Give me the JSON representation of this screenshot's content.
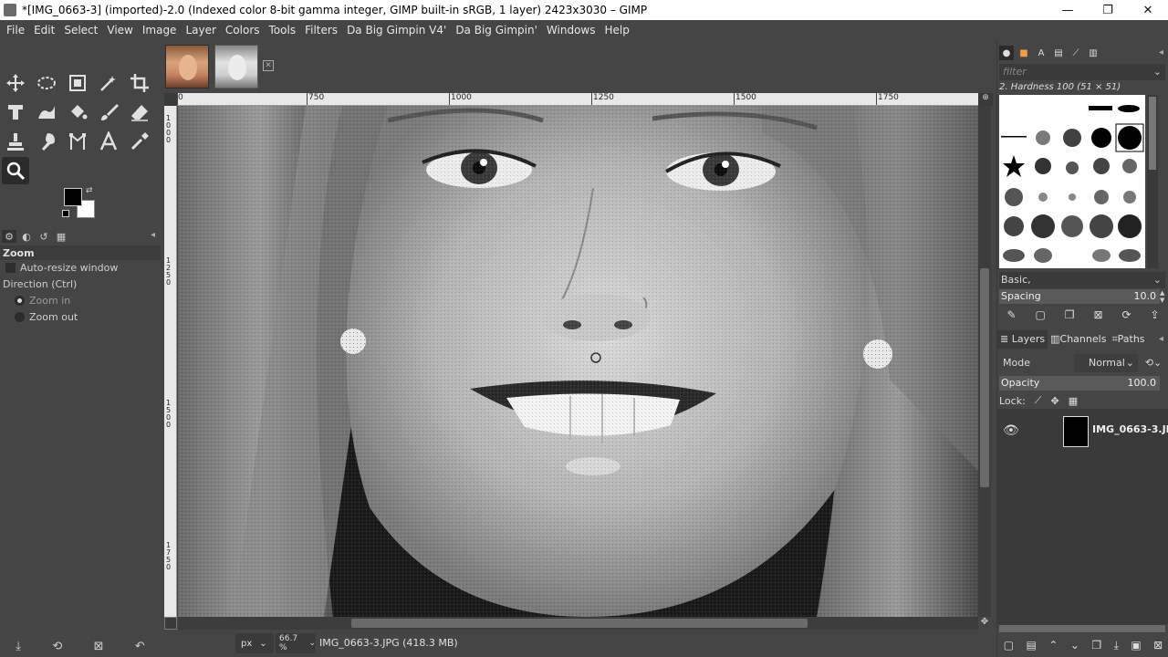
{
  "window": {
    "title": "*[IMG_0663-3] (imported)-2.0 (Indexed color 8-bit gamma integer, GIMP built-in sRGB, 1 layer) 2423x3030 – GIMP",
    "minimize": "—",
    "restore": "❐",
    "close": "✕"
  },
  "menu": [
    "File",
    "Edit",
    "Select",
    "View",
    "Image",
    "Layer",
    "Colors",
    "Tools",
    "Filters",
    "Da Big Gimpin V4'",
    "Da Big Gimpin'",
    "Windows",
    "Help"
  ],
  "toolbox": {
    "tools": [
      "move-tool-icon",
      "ellipse-select-icon",
      "crop-to-content-icon",
      "fuzzy-select-icon",
      "crop-icon",
      "unified-transform-icon",
      "warp-icon",
      "bucket-fill-icon",
      "paintbrush-icon",
      "eraser-icon",
      "clone-icon",
      "smudge-icon",
      "paths-icon",
      "text-icon",
      "color-picker-icon",
      "zoom-icon"
    ],
    "active_tool": "zoom-icon",
    "fg_color": "#000000",
    "bg_color": "#ffffff"
  },
  "tool_options": {
    "title": "Zoom",
    "auto_resize_label": "Auto-resize window",
    "direction_label": "Direction  (Ctrl)",
    "zoom_in_label": "Zoom in",
    "zoom_out_label": "Zoom out",
    "selected_direction": "Zoom in"
  },
  "ruler": {
    "h_labels": [
      "750",
      "1000",
      "1250",
      "1500",
      "1750"
    ],
    "v_labels": [
      "1000",
      "1250",
      "1500",
      "1750"
    ]
  },
  "statusbar": {
    "unit": "px",
    "zoom": "66.7 %",
    "file_info": "IMG_0663-3.JPG (418.3 MB)"
  },
  "brushes": {
    "filter_placeholder": "filter",
    "current_brush": "2. Hardness 100 (51 × 51)",
    "preset": "Basic,",
    "spacing_label": "Spacing",
    "spacing_value": "10.0"
  },
  "layers_panel": {
    "tabs": [
      "Layers",
      "Channels",
      "Paths"
    ],
    "mode_label": "Mode",
    "mode_value": "Normal",
    "opacity_label": "Opacity",
    "opacity_value": "100.0",
    "lock_label": "Lock:",
    "layers": [
      {
        "name": "IMG_0663-3.JP",
        "visible": true
      }
    ]
  }
}
